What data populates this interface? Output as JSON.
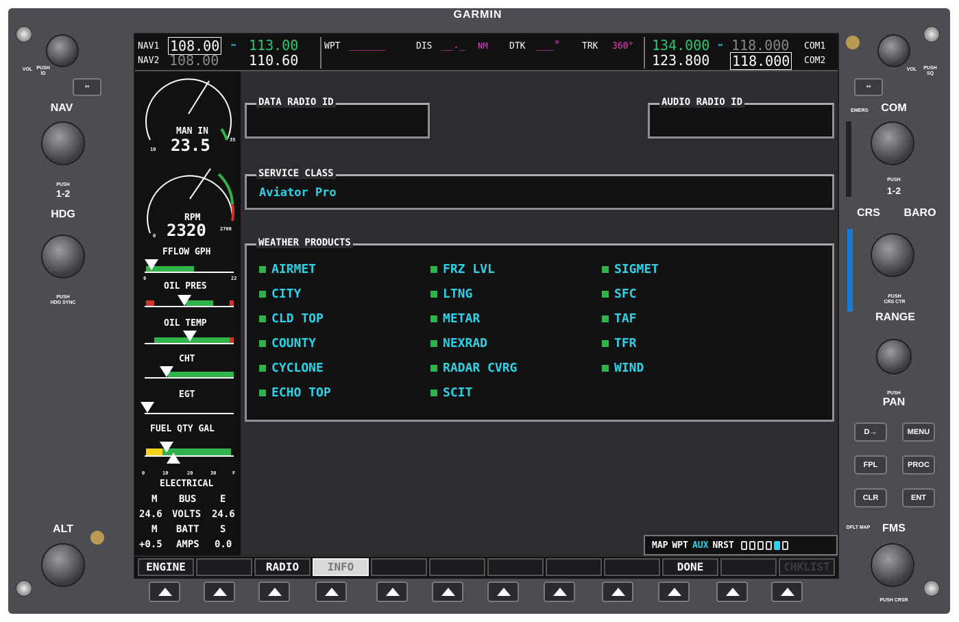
{
  "brand": "GARMIN",
  "left_bezel": {
    "vol_label": "VOL",
    "push_id_label": "PUSH\nID",
    "swap_label": "↔",
    "nav_label": "NAV",
    "push_12_label": "PUSH",
    "one_two": "1-2",
    "hdg_label": "HDG",
    "push_hdg_sync": "PUSH\nHDG SYNC",
    "alt_label": "ALT"
  },
  "right_bezel": {
    "vol_label": "VOL",
    "push_sq_label": "PUSH\nSQ",
    "swap_label": "↔",
    "emerg_label": "EMERG",
    "com_label": "COM",
    "push_12_label": "PUSH",
    "one_two": "1-2",
    "crs_label": "CRS",
    "baro_label": "BARO",
    "push_crs_ctr": "PUSH\nCRS CTR",
    "range_label": "RANGE",
    "push_pan": "PUSH",
    "pan_label": "PAN",
    "keys": [
      "D→",
      "MENU",
      "FPL",
      "PROC",
      "CLR",
      "ENT"
    ],
    "dflt_map": "DFLT MAP",
    "fms_label": "FMS",
    "push_crsr": "PUSH CRSR"
  },
  "nav": {
    "nav1_label": "NAV1",
    "nav1_active": "108.00",
    "nav1_standby": "113.00",
    "nav2_label": "NAV2",
    "nav2_active": "108.00",
    "nav2_standby": "110.60",
    "arrow": "↔"
  },
  "nav_data": {
    "wpt_label": "WPT",
    "wpt_value": "______",
    "dis_label": "DIS",
    "dis_value": "__._",
    "dis_unit": "NM",
    "dtk_label": "DTK",
    "dtk_value": "___°",
    "trk_label": "TRK",
    "trk_value": "360°"
  },
  "com": {
    "com1_active": "134.000",
    "com1_standby": "118.000",
    "com1_label": "COM1",
    "com2_active": "123.800",
    "com2_standby": "118.000",
    "com2_label": "COM2",
    "arrow": "↔"
  },
  "engine": {
    "man_in_label": "MAN IN",
    "man_in_value": "23.5",
    "man_in_min": "10",
    "man_in_max": "35",
    "rpm_label": "RPM",
    "rpm_value": "2320",
    "rpm_min": "0",
    "rpm_max": "2700",
    "fflow_label": "FFLOW GPH",
    "fflow_min": "0",
    "fflow_max": "22",
    "oil_pres_label": "OIL PRES",
    "oil_temp_label": "OIL TEMP",
    "cht_label": "CHT",
    "egt_label": "EGT",
    "fuel_label": "FUEL QTY GAL",
    "fuel_ticks": [
      "0",
      "10",
      "20",
      "30",
      "F"
    ],
    "electrical_label": "ELECTRICAL",
    "bus_row": [
      "M",
      "BUS",
      "E"
    ],
    "volts_row": [
      "24.6",
      "VOLTS",
      "24.6"
    ],
    "batt_row": [
      "M",
      "BATT",
      "S"
    ],
    "amps_row": [
      "+0.5",
      "AMPS",
      "0.0"
    ]
  },
  "panels": {
    "data_radio_id": "DATA RADIO ID",
    "audio_radio_id": "AUDIO RADIO ID",
    "service_class": "SERVICE CLASS",
    "service_class_value": "Aviator Pro",
    "weather_products": "WEATHER PRODUCTS"
  },
  "weather_products": [
    [
      "AIRMET",
      "CITY",
      "CLD TOP",
      "COUNTY",
      "CYCLONE",
      "ECHO TOP"
    ],
    [
      "FRZ LVL",
      "LTNG",
      "METAR",
      "NEXRAD",
      "RADAR CVRG",
      "SCIT"
    ],
    [
      "SIGMET",
      "SFC",
      "TAF",
      "TFR",
      "WIND"
    ]
  ],
  "page_group": {
    "pages": [
      "MAP",
      "WPT",
      "AUX",
      "NRST"
    ],
    "active": "AUX"
  },
  "softkeys": [
    "ENGINE",
    "",
    "RADIO",
    "INFO",
    "",
    "",
    "",
    "",
    "",
    "DONE",
    "",
    "CHKLIST"
  ],
  "colors": {
    "bezel": "#4c4d52",
    "screen_bg": "#2b2d31",
    "cyan": "#29d3e8",
    "green": "#2ec86e",
    "magenta": "#e040c0"
  }
}
